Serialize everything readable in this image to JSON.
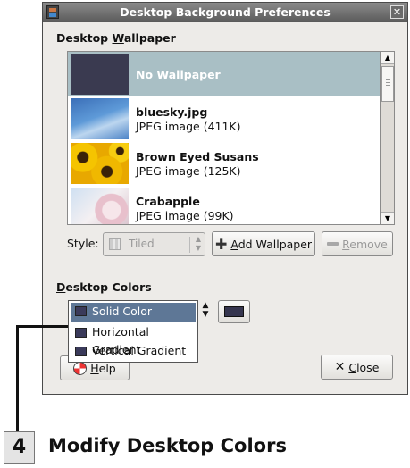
{
  "window": {
    "title": "Desktop Background Preferences",
    "close_glyph": "✕"
  },
  "wallpaper": {
    "section_label_prefix": "Desktop ",
    "section_label_mnemonic": "W",
    "section_label_suffix": "allpaper",
    "items": [
      {
        "name": "No Wallpaper",
        "desc": "",
        "thumb": "none",
        "selected": true
      },
      {
        "name": "bluesky.jpg",
        "desc": "JPEG image (411K)",
        "thumb": "bluesky",
        "selected": false
      },
      {
        "name": "Brown Eyed Susans",
        "desc": "JPEG image (125K)",
        "thumb": "susans",
        "selected": false
      },
      {
        "name": "Crabapple",
        "desc": "JPEG image (99K)",
        "thumb": "crabapple",
        "selected": false
      }
    ]
  },
  "style": {
    "label": "Style:",
    "value": "Tiled"
  },
  "buttons": {
    "add_mnemonic": "A",
    "add_rest": "dd Wallpaper",
    "remove_mnemonic": "R",
    "remove_rest": "emove",
    "help_mnemonic": "H",
    "help_rest": "elp",
    "close_mnemonic": "C",
    "close_rest": "lose"
  },
  "colors": {
    "section_label_mnemonic": "D",
    "section_label_rest": "esktop Colors",
    "options": [
      "Solid Color",
      "Horizontal Gradient",
      "Vertical Gradient"
    ],
    "selected": "Solid Color",
    "swatch_color": "#35354f"
  },
  "callout": {
    "step": "4",
    "title": "Modify Desktop Colors"
  },
  "icons": {
    "add": "plus-icon",
    "remove": "minus-icon",
    "help": "help-lifebuoy-icon",
    "close": "close-x-icon"
  }
}
